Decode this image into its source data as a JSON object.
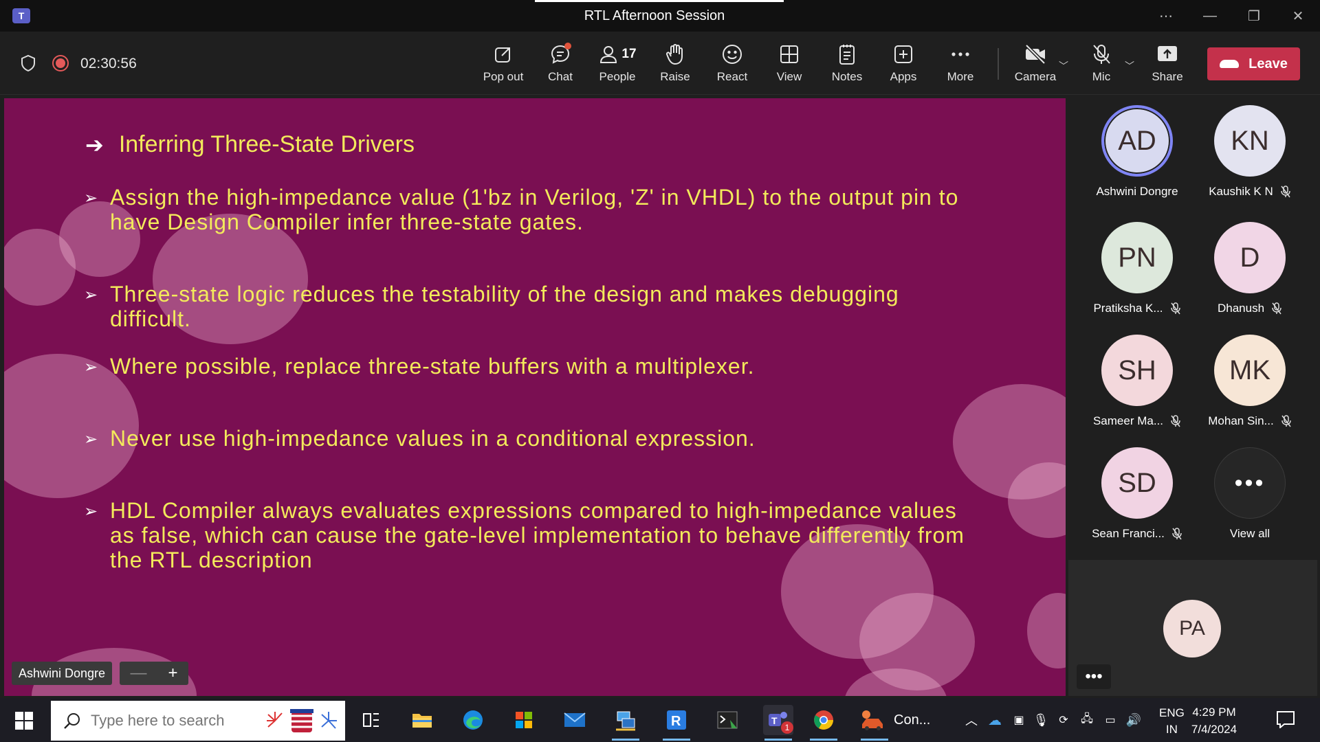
{
  "window": {
    "title": "RTL Afternoon Session"
  },
  "toolbar": {
    "timer": "02:30:56",
    "buttons": [
      {
        "label": "Pop out",
        "icon": "pop-out-icon"
      },
      {
        "label": "Chat",
        "icon": "chat-icon"
      },
      {
        "label": "People",
        "icon": "people-icon",
        "count": "17"
      },
      {
        "label": "Raise",
        "icon": "raise-hand-icon"
      },
      {
        "label": "React",
        "icon": "react-icon"
      },
      {
        "label": "View",
        "icon": "view-icon"
      },
      {
        "label": "Notes",
        "icon": "notes-icon"
      },
      {
        "label": "Apps",
        "icon": "apps-icon"
      },
      {
        "label": "More",
        "icon": "more-icon"
      }
    ],
    "camera_label": "Camera",
    "mic_label": "Mic",
    "share_label": "Share",
    "leave_label": "Leave"
  },
  "slide": {
    "heading": "Inferring Three-State Drivers",
    "bullets": [
      {
        "line1": "Assign the high-impedance value (1'bz in Verilog, 'Z' in VHDL) to the output pin to",
        "line2": "have Design Compiler infer three-state gates.",
        "line3": ""
      },
      {
        "line1": "Three-state logic reduces the testability of the design and makes debugging",
        "line2": "difficult.",
        "line3": ""
      },
      {
        "line1": "Where possible, replace three-state buffers with a multiplexer.",
        "line2": "",
        "line3": ""
      },
      {
        "line1": "Never use high-impedance values in a conditional expression.",
        "line2": "",
        "line3": ""
      },
      {
        "line1": "HDL Compiler always evaluates expressions compared to high-impedance values",
        "line2": "as false, which can cause the gate-level implementation to behave differently from",
        "line3": "the RTL description"
      }
    ],
    "presenter": "Ashwini Dongre",
    "zoom_out": "—",
    "zoom_in": "+"
  },
  "participants": [
    {
      "initials": "AD",
      "name": "Ashwini Dongre",
      "muted": false,
      "color": "#d8daf0",
      "speaking": true
    },
    {
      "initials": "KN",
      "name": "Kaushik K N",
      "muted": true,
      "color": "#e3e3f0",
      "speaking": false
    },
    {
      "initials": "PN",
      "name": "Pratiksha K...",
      "muted": true,
      "color": "#dde8dc",
      "speaking": false
    },
    {
      "initials": "D",
      "name": "Dhanush",
      "muted": true,
      "color": "#f1d6e6",
      "speaking": false
    },
    {
      "initials": "SH",
      "name": "Sameer Ma...",
      "muted": true,
      "color": "#f3d8dc",
      "speaking": false
    },
    {
      "initials": "MK",
      "name": "Mohan Sin...",
      "muted": true,
      "color": "#f7e6d6",
      "speaking": false
    },
    {
      "initials": "SD",
      "name": "Sean Franci...",
      "muted": true,
      "color": "#f1d3e3",
      "speaking": false
    }
  ],
  "view_all": {
    "label": "View all",
    "glyph": "•••"
  },
  "self_view": {
    "initials": "PA",
    "more_glyph": "•••"
  },
  "taskbar": {
    "search_placeholder": "Type here to search",
    "running_app_label": "Con...",
    "teams_badge": "1",
    "lang_line1": "ENG",
    "lang_line2": "IN",
    "time": "4:29 PM",
    "date": "7/4/2024"
  }
}
